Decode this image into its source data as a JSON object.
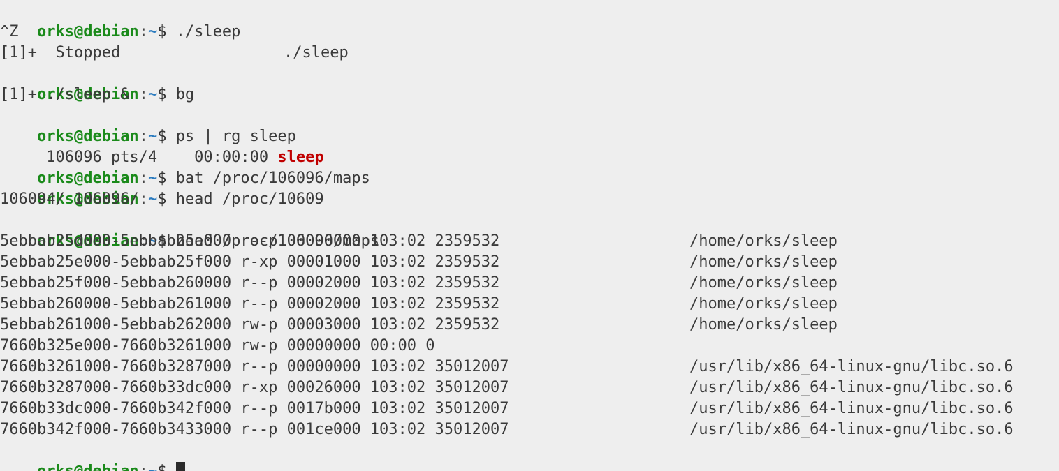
{
  "prompt": {
    "user": "orks@debian",
    "sep": ":",
    "cwd": "~",
    "dollar": "$ "
  },
  "colors": {
    "background": "#eeeeee",
    "prompt_user": "#1a8a1a",
    "prompt_cwd": "#2b7bbf",
    "match": "#c00000",
    "text": "#3a3a3a"
  },
  "commands": {
    "c1": "./sleep",
    "c2": "bg",
    "c3": "ps | rg sleep",
    "c4": "bat /proc/106096/maps",
    "c5": "head /proc/10609",
    "c6": "head /proc/106096/maps"
  },
  "output": {
    "ctrlz": "^Z",
    "stopped_job": "[1]+  Stopped",
    "stopped_cmd": "./sleep",
    "bg_job": "[1]+ ./sleep &",
    "ps_prefix": " 106096 pts/4    00:00:00 ",
    "ps_match": "sleep",
    "completion": "106094/ 106096/"
  },
  "maps": [
    {
      "main": "5ebbab25d000-5ebbab25e000 r--p 00000000 103:02 2359532",
      "path": "/home/orks/sleep"
    },
    {
      "main": "5ebbab25e000-5ebbab25f000 r-xp 00001000 103:02 2359532",
      "path": "/home/orks/sleep"
    },
    {
      "main": "5ebbab25f000-5ebbab260000 r--p 00002000 103:02 2359532",
      "path": "/home/orks/sleep"
    },
    {
      "main": "5ebbab260000-5ebbab261000 r--p 00002000 103:02 2359532",
      "path": "/home/orks/sleep"
    },
    {
      "main": "5ebbab261000-5ebbab262000 rw-p 00003000 103:02 2359532",
      "path": "/home/orks/sleep"
    },
    {
      "main": "7660b325e000-7660b3261000 rw-p 00000000 00:00 0",
      "path": ""
    },
    {
      "main": "7660b3261000-7660b3287000 r--p 00000000 103:02 35012007",
      "path": "/usr/lib/x86_64-linux-gnu/libc.so.6"
    },
    {
      "main": "7660b3287000-7660b33dc000 r-xp 00026000 103:02 35012007",
      "path": "/usr/lib/x86_64-linux-gnu/libc.so.6"
    },
    {
      "main": "7660b33dc000-7660b342f000 r--p 0017b000 103:02 35012007",
      "path": "/usr/lib/x86_64-linux-gnu/libc.so.6"
    },
    {
      "main": "7660b342f000-7660b3433000 r--p 001ce000 103:02 35012007",
      "path": "/usr/lib/x86_64-linux-gnu/libc.so.6"
    }
  ]
}
